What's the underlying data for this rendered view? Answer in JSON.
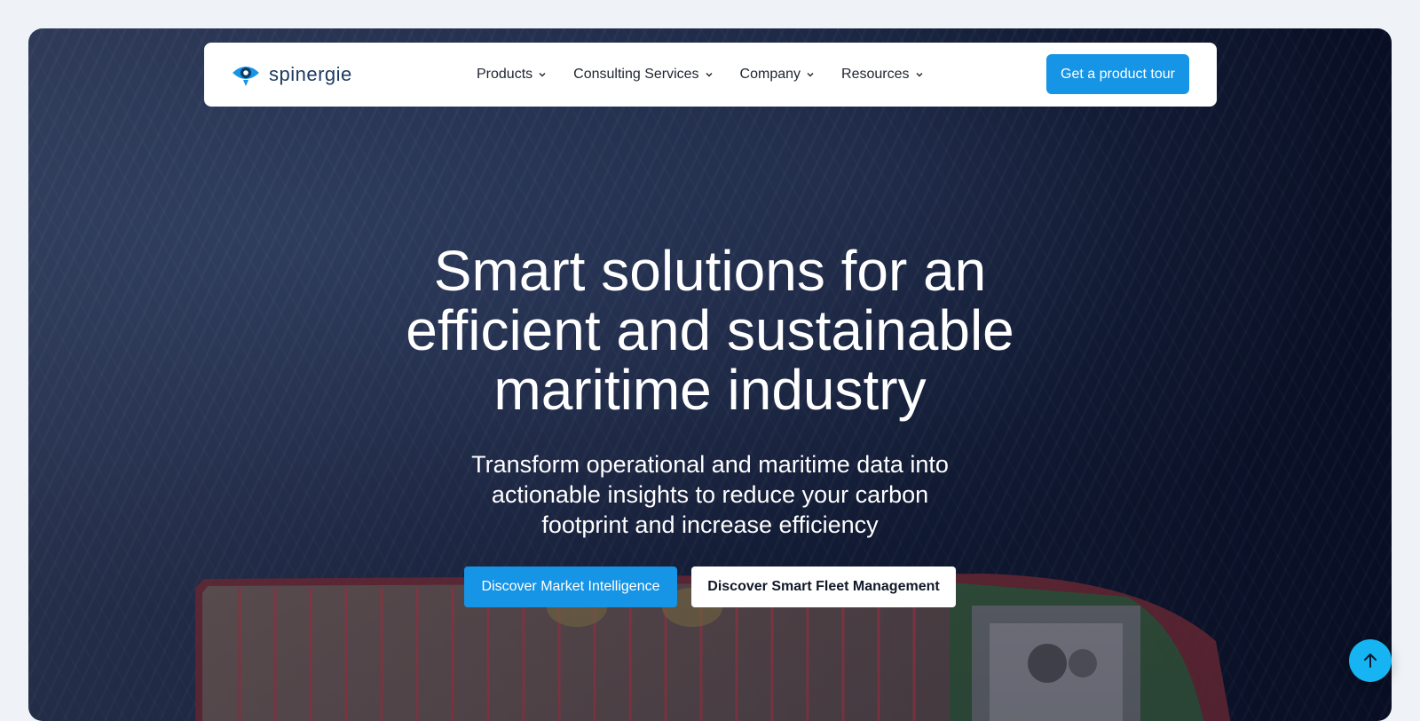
{
  "nav": {
    "logo_text": "spinergie",
    "items": [
      {
        "label": "Products"
      },
      {
        "label": "Consulting Services"
      },
      {
        "label": "Company"
      },
      {
        "label": "Resources"
      }
    ],
    "cta_label": "Get a product tour"
  },
  "hero": {
    "headline": "Smart solutions for an efficient and sustainable maritime industry",
    "subheadline": "Transform operational and maritime data into actionable insights to reduce your carbon footprint and increase efficiency",
    "primary_button": "Discover Market Intelligence",
    "secondary_button": "Discover Smart Fleet Management"
  },
  "icons": {
    "logo": "eye-logo-icon",
    "dropdown": "chevron-down-icon",
    "scroll_top": "arrow-up-icon"
  },
  "colors": {
    "accent": "#1694e6",
    "scroll_button": "#16b4f2",
    "logo_text": "#1d3a5f"
  }
}
